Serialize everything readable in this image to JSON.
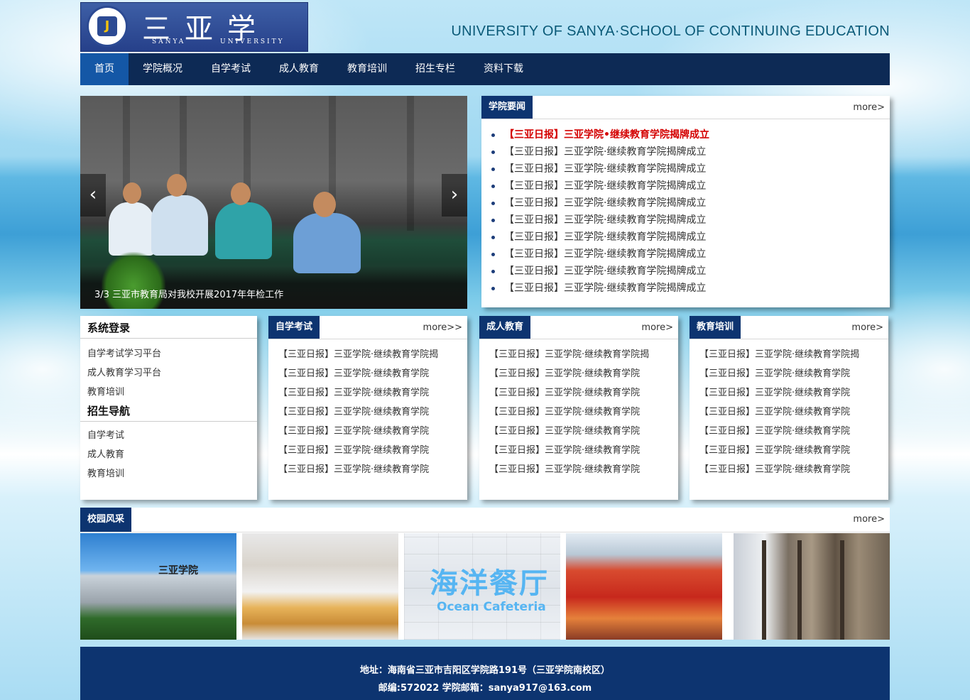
{
  "header": {
    "logo_cn": "三亚学院",
    "logo_en_left": "SANYA",
    "logo_en_right": "UNIVERSITY",
    "site_title": "UNIVERSITY OF SANYA·SCHOOL OF CONTINUING EDUCATION"
  },
  "nav": {
    "items": [
      "首页",
      "学院概况",
      "自学考试",
      "成人教育",
      "教育培训",
      "招生专栏",
      "资料下载"
    ],
    "active": "首页"
  },
  "slider": {
    "prev_icon": "‹",
    "next_icon": "›",
    "caption": "3/3  三亚市教育局对我校开展2017年年检工作"
  },
  "news": {
    "title": "学院要闻",
    "more": "more>",
    "items": [
      "【三亚日报】三亚学院•继续教育学院揭牌成立",
      "【三亚日报】三亚学院·继续教育学院揭牌成立",
      "【三亚日报】三亚学院·继续教育学院揭牌成立",
      "【三亚日报】三亚学院·继续教育学院揭牌成立",
      "【三亚日报】三亚学院·继续教育学院揭牌成立",
      "【三亚日报】三亚学院·继续教育学院揭牌成立",
      "【三亚日报】三亚学院·继续教育学院揭牌成立",
      "【三亚日报】三亚学院·继续教育学院揭牌成立",
      "【三亚日报】三亚学院·继续教育学院揭牌成立",
      "【三亚日报】三亚学院·继续教育学院揭牌成立"
    ]
  },
  "login": {
    "title": "系统登录",
    "items": [
      "自学考试学习平台",
      "成人教育学习平台",
      "教育培训"
    ],
    "nav_title": "招生导航",
    "nav_items": [
      "自学考试",
      "成人教育",
      "教育培训"
    ]
  },
  "columns": [
    {
      "title": "自学考试",
      "more": "more>>",
      "items": [
        "【三亚日报】三亚学院·继续教育学院揭",
        "【三亚日报】三亚学院·继续教育学院",
        "【三亚日报】三亚学院·继续教育学院",
        "【三亚日报】三亚学院·继续教育学院",
        "【三亚日报】三亚学院·继续教育学院",
        "【三亚日报】三亚学院·继续教育学院",
        "【三亚日报】三亚学院·继续教育学院"
      ]
    },
    {
      "title": "成人教育",
      "more": "more>",
      "items": [
        "【三亚日报】三亚学院·继续教育学院揭",
        "【三亚日报】三亚学院·继续教育学院",
        "【三亚日报】三亚学院·继续教育学院",
        "【三亚日报】三亚学院·继续教育学院",
        "【三亚日报】三亚学院·继续教育学院",
        "【三亚日报】三亚学院·继续教育学院",
        "【三亚日报】三亚学院·继续教育学院"
      ]
    },
    {
      "title": "教育培训",
      "more": "more>",
      "items": [
        "【三亚日报】三亚学院·继续教育学院揭",
        "【三亚日报】三亚学院·继续教育学院",
        "【三亚日报】三亚学院·继续教育学院",
        "【三亚日报】三亚学院·继续教育学院",
        "【三亚日报】三亚学院·继续教育学院",
        "【三亚日报】三亚学院·继续教育学院",
        "【三亚日报】三亚学院·继续教育学院"
      ]
    }
  ],
  "campus": {
    "title": "校园风采",
    "more": "more>",
    "sign_cn": "海洋餐厅",
    "sign_en": "Ocean Cafeteria",
    "building_sign": "三亚学院"
  },
  "footer": {
    "address": "地址：海南省三亚市吉阳区学院路191号（三亚学院南校区）",
    "contact": "邮编:572022 学院邮箱：sanya917@163.com"
  },
  "colors": {
    "nav_bg": "#0d2a55",
    "nav_active": "#1457a6",
    "tab_bg": "#0d3470",
    "headline_red": "#d40000"
  }
}
